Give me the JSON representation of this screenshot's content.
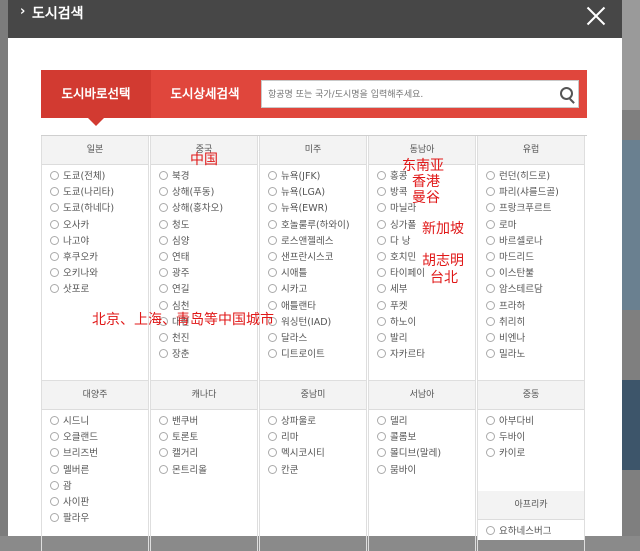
{
  "modal": {
    "title": "도시검색",
    "title_chevron": "›"
  },
  "tabs": {
    "active": "도시바로선택",
    "second": "도시상세검색"
  },
  "search": {
    "placeholder": "항공명 또는 국가/도시명을 입력해주세요."
  },
  "columns_top": [
    {
      "header": "일본",
      "cities": [
        "도쿄(전체)",
        "도쿄(나리타)",
        "도쿄(하네다)",
        "오사카",
        "나고야",
        "후쿠오카",
        "오키나와",
        "삿포로"
      ]
    },
    {
      "header": "중국",
      "cities": [
        "북경",
        "상해(푸동)",
        "상해(홍차오)",
        "청도",
        "심양",
        "연태",
        "광주",
        "연길",
        "심천",
        "대련",
        "천진",
        "장춘"
      ]
    },
    {
      "header": "미주",
      "cities": [
        "뉴욕(JFK)",
        "뉴욕(LGA)",
        "뉴욕(EWR)",
        "호놀룰루(하와이)",
        "로스앤젤레스",
        "샌프란시스코",
        "시애틀",
        "시카고",
        "애틀랜타",
        "워싱턴(IAD)",
        "달라스",
        "디트로이트"
      ]
    },
    {
      "header": "동남아",
      "cities": [
        "홍콩",
        "방콕",
        "마닐라",
        "싱가폴",
        "다 낭",
        "호치민",
        "타이페이",
        "세부",
        "푸켓",
        "하노이",
        "발리",
        "자카르타"
      ]
    },
    {
      "header": "유럽",
      "cities": [
        "런던(히드로)",
        "파리(샤를드골)",
        "프랑크푸르트",
        "로마",
        "바르셀로나",
        "마드리드",
        "이스탄불",
        "암스테르담",
        "프라하",
        "취리히",
        "비엔나",
        "밀라노"
      ]
    }
  ],
  "columns_bottom": [
    {
      "header": "대양주",
      "cities": [
        "시드니",
        "오클랜드",
        "브리즈번",
        "멜버른",
        "괌",
        "사이판",
        "팔라우"
      ]
    },
    {
      "header": "캐나다",
      "cities": [
        "밴쿠버",
        "토론토",
        "캘거리",
        "몬트리올"
      ]
    },
    {
      "header": "중남미",
      "cities": [
        "상파울로",
        "리마",
        "멕시코시티",
        "칸쿤"
      ]
    },
    {
      "header": "서남아",
      "cities": [
        "델리",
        "콜롬보",
        "몰디브(말레)",
        "뭄바이"
      ]
    },
    {
      "header": "중동",
      "cities": [
        "아부다비",
        "두바이",
        "카이로"
      ]
    }
  ],
  "extra_column": {
    "header": "아프리카",
    "cities": [
      "요하네스버그"
    ]
  },
  "annotations": {
    "china": "中国",
    "southeast_asia": "东南亚",
    "hongkong": "香港",
    "bangkok": "曼谷",
    "singapore": "新加坡",
    "hcmc": "胡志明",
    "taipei": "台北",
    "china_cities": "北京、上海、青岛等中国城市"
  },
  "colors": {
    "accent": "#e0463c",
    "accent_dark": "#d23a31",
    "titlebar": "#474747",
    "annotation": "#e01818"
  }
}
